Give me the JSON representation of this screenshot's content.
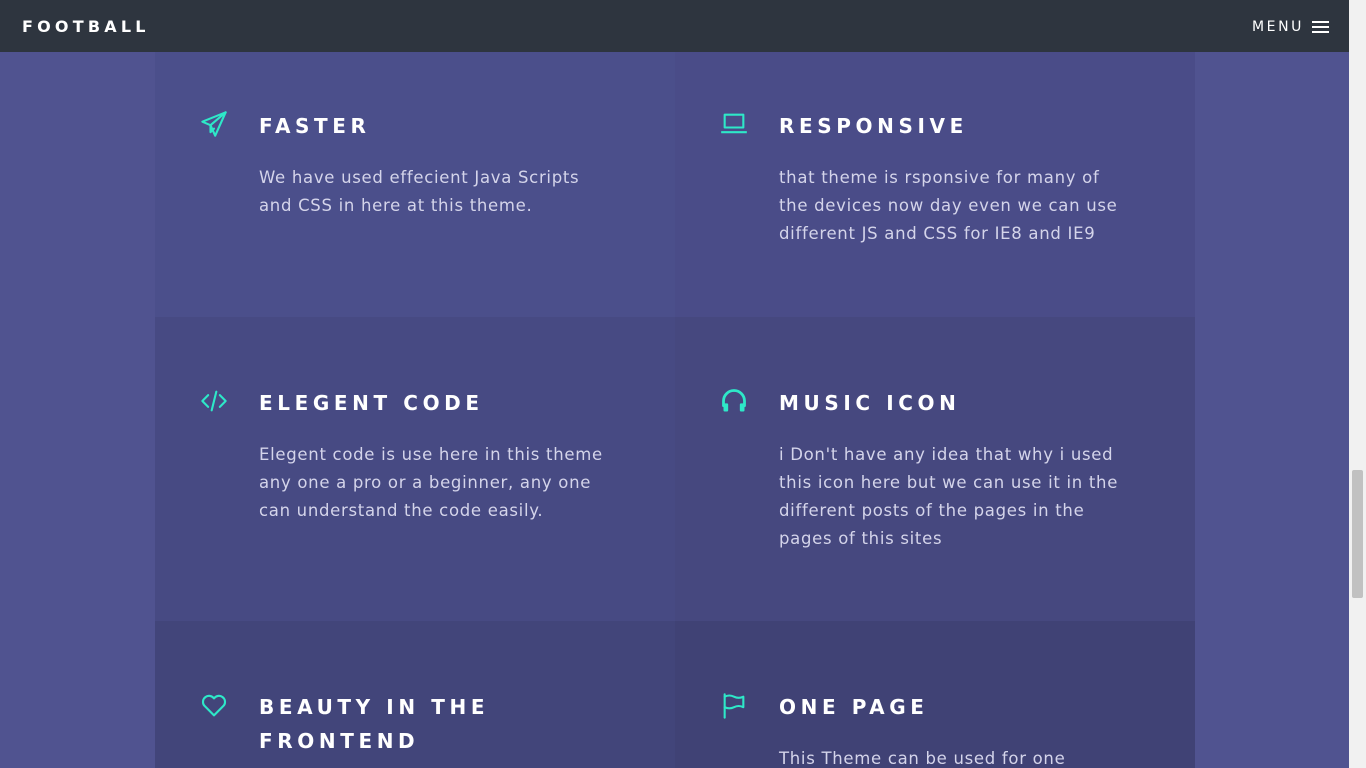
{
  "navbar": {
    "brand": "FOOTBALL",
    "menu_label": "MENU"
  },
  "colors": {
    "page_bg": "#505390",
    "nav_bg": "#2e353f",
    "accent": "#2ee8c8"
  },
  "features": [
    {
      "icon": "paper-plane-icon",
      "title": "FASTER",
      "description": "We have used effecient Java Scripts and CSS in here at this theme."
    },
    {
      "icon": "laptop-icon",
      "title": "RESPONSIVE",
      "description": "that theme is rsponsive for many of the devices now day even we can use different JS and CSS for IE8 and IE9"
    },
    {
      "icon": "code-icon",
      "title": "ELEGENT CODE",
      "description": "Elegent code is use here in this theme any one a pro or a beginner, any one can understand the code easily."
    },
    {
      "icon": "headphones-icon",
      "title": "MUSIC ICON",
      "description": "i Don't have any idea that why i used this icon here but we can use it in the different posts of the pages in the pages of this sites"
    },
    {
      "icon": "heart-icon",
      "title": "BEAUTY IN THE FRONTEND",
      "description": ""
    },
    {
      "icon": "flag-icon",
      "title": "ONE PAGE",
      "description": "This Theme can be used for one"
    }
  ]
}
